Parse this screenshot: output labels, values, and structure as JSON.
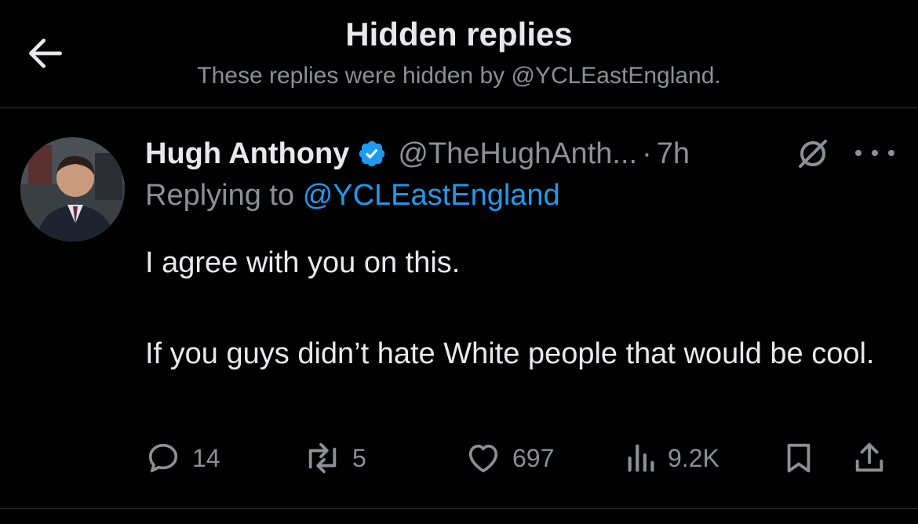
{
  "header": {
    "title": "Hidden replies",
    "subtitle": "These replies were hidden by @YCLEastEngland.",
    "back_icon": "arrow-left-icon"
  },
  "tweet": {
    "author_name": "Hugh Anthony",
    "handle": "@TheHughAnth...",
    "separator": "·",
    "time": "7h",
    "replying_prefix": "Replying to",
    "replying_to": "@YCLEastEngland",
    "text_line1": "I agree with you on this.",
    "text_line2": "If you guys didn’t hate White people that would be cool.",
    "icons": [
      "verified-badge-icon",
      "grok-icon",
      "more-icon"
    ]
  },
  "actions": {
    "replies": "14",
    "reposts": "5",
    "likes": "697",
    "views": "9.2K"
  },
  "colors": {
    "background": "#000000",
    "text": "#e7e9ea",
    "muted": "#8b9096",
    "accent": "#1d9bf0",
    "divider": "#2f3336"
  }
}
